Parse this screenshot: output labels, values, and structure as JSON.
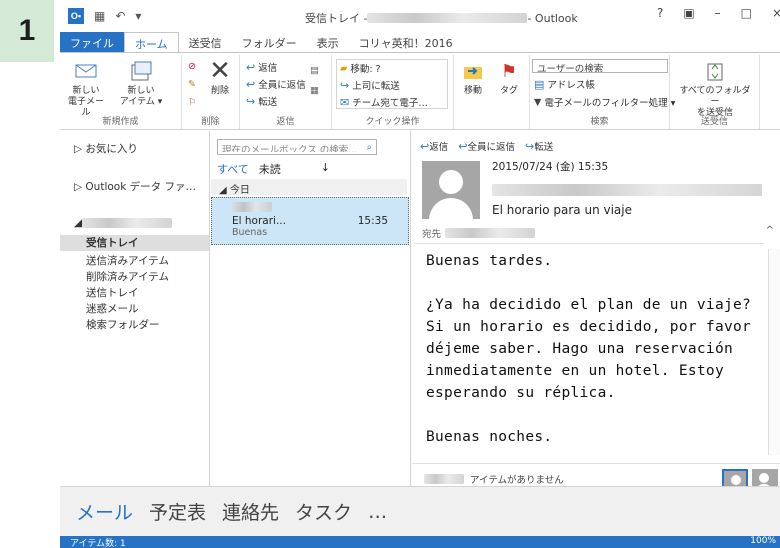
{
  "step_number": "1",
  "titlebar": {
    "title_prefix": "受信トレイ - ",
    "title_suffix": " - Outlook",
    "help": "?",
    "restore": "▣",
    "minimize": "–",
    "maximize": "□",
    "close": "×",
    "olk": "O▪"
  },
  "qat": {
    "save_icon": "▦",
    "undo_icon": "↶",
    "more_icon": "▾"
  },
  "tabs": [
    "ファイル",
    "ホーム",
    "送受信",
    "フォルダー",
    "表示",
    "コリャ英和！2016"
  ],
  "ribbon": {
    "new_mail": "新しい\n電子メール",
    "new_items": "新しい\nアイテム ▾",
    "delete": "削除",
    "reply": "返信",
    "reply_all": "全員に返信",
    "forward": "転送",
    "move_to": "移動: ?",
    "to_manager": "上司に転送",
    "team_email": "チーム宛て電子…",
    "move": "移動",
    "tags": "タグ",
    "search_people": "ユーザーの検索",
    "address_book": "アドレス帳",
    "filter_email": "電子メールのフィルター処理 ▾",
    "send_receive_all": "すべてのフォルダー\nを送受信",
    "groups": {
      "new": "新規作成",
      "delete": "削除",
      "respond": "返信",
      "quick_steps": "クイック操作",
      "find": "検索",
      "send_receive": "送受信"
    }
  },
  "nav": {
    "favorites": "▷ お気に入り",
    "data_file": "▷ Outlook データ ファ…",
    "account_prefix": "◢ ",
    "folders": [
      "受信トレイ",
      "送信済みアイテム",
      "削除済みアイテム",
      "送信トレイ",
      "迷惑メール",
      "検索フォルダー"
    ]
  },
  "list": {
    "search_placeholder": "現在のメールボックス の検索…",
    "search_icon": "⌕",
    "filter_all": "すべて",
    "filter_unread": "未読",
    "sort_icon": "↓",
    "today": "◢ 今日",
    "message": {
      "subject": "El horari...",
      "time": "15:35",
      "preview": "Buenas"
    }
  },
  "reading": {
    "reply": "返信",
    "reply_all": "全員に返信",
    "forward": "転送",
    "date": "2015/07/24 (金) 15:35",
    "subject": "El horario para un viaje",
    "to_label": "宛先",
    "body": "Buenas tardes.\n\n¿Ya ha decidido el plan de un viaje?\nSi un horario es decidido, por favor\ndéjeme saber. Hago una reservación\ninmediatamente en un hotel. Estoy\nesperando su réplica.\n\nBuenas noches.",
    "people_status": "アイテムがありません"
  },
  "bottom_nav": [
    "メール",
    "予定表",
    "連絡先",
    "タスク",
    "…"
  ],
  "status": {
    "items": "アイテム数: 1",
    "zoom": "100%"
  },
  "colors": {
    "accent": "#2672c5",
    "selection": "#cde6f7",
    "step_bg": "#d4e9d6"
  }
}
